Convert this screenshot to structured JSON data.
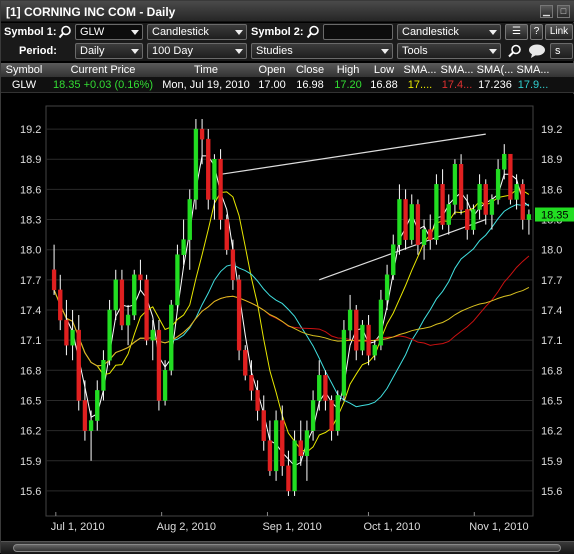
{
  "window": {
    "title": "[1] CORNING INC COM - Daily"
  },
  "toolbar": {
    "symbol1_label": "Symbol 1:",
    "symbol1_value": "GLW",
    "chart_type1": "Candlestick",
    "symbol2_label": "Symbol 2:",
    "symbol2_value": "",
    "chart_type2": "Candlestick",
    "help_label": "?",
    "link_label": "Link",
    "period_label": "Period:",
    "period_value": "Daily",
    "range_value": "100 Day",
    "studies_value": "Studies",
    "tools_value": "Tools",
    "extra_label": "s"
  },
  "quote": {
    "headers": [
      "Symbol",
      "Current Price",
      "Time",
      "Open",
      "Close",
      "High",
      "Low",
      "SMA...",
      "SMA...",
      "SMA(...",
      "SMA..."
    ],
    "row": {
      "symbol": "GLW",
      "price": "18.35 +0.03 (0.16%)",
      "time": "Mon, Jul 19, 2010",
      "open": "17.00",
      "close": "16.98",
      "high": "17.20",
      "low": "16.88",
      "sma1": "17....",
      "sma2": "17.4...",
      "sma3": "17.236",
      "sma4": "17.9..."
    },
    "colors": {
      "price": "#33dd33",
      "high": "#33dd33",
      "sma1": "#e8e800",
      "sma2": "#e03030",
      "sma4": "#30d0d0"
    }
  },
  "chart_data": {
    "type": "candlestick",
    "ylim": [
      15.45,
      19.35
    ],
    "y_ticks": [
      15.6,
      15.9,
      16.2,
      16.5,
      16.8,
      17.1,
      17.4,
      17.7,
      18.0,
      18.3,
      18.6,
      18.9,
      19.2
    ],
    "x_tick_labels": [
      "Jul 1, 2010",
      "Aug 2, 2010",
      "Sep 1, 2010",
      "Oct 1, 2010",
      "Nov 1, 2010"
    ],
    "last_price_label": "18.35",
    "colors": {
      "up": "#22dd22",
      "down": "#e02020",
      "sma_fast": "#ffffff",
      "sma_short": "#e8e800",
      "sma_mid": "#40e0e0",
      "sma_long": "#cc1111",
      "sma_slow": "#d8c020",
      "channel": "#dddddd",
      "grid": "#2a2a2a"
    },
    "candles": [
      [
        17.8,
        18.05,
        17.55,
        17.6
      ],
      [
        17.6,
        17.75,
        17.2,
        17.3
      ],
      [
        17.3,
        17.5,
        16.95,
        17.05
      ],
      [
        17.05,
        17.4,
        16.9,
        17.2
      ],
      [
        17.2,
        17.35,
        16.4,
        16.5
      ],
      [
        16.5,
        16.7,
        16.1,
        16.2
      ],
      [
        16.2,
        16.4,
        15.9,
        16.3
      ],
      [
        16.3,
        16.7,
        16.2,
        16.6
      ],
      [
        16.6,
        17.0,
        16.5,
        16.9
      ],
      [
        16.9,
        17.5,
        16.85,
        17.4
      ],
      [
        17.4,
        17.8,
        17.3,
        17.7
      ],
      [
        17.7,
        17.8,
        17.2,
        17.25
      ],
      [
        17.25,
        17.45,
        17.05,
        17.35
      ],
      [
        17.35,
        17.8,
        17.3,
        17.75
      ],
      [
        17.75,
        17.9,
        17.6,
        17.7
      ],
      [
        17.7,
        17.75,
        17.05,
        17.1
      ],
      [
        17.1,
        17.3,
        16.9,
        17.2
      ],
      [
        17.2,
        17.3,
        16.4,
        16.5
      ],
      [
        16.5,
        16.9,
        16.45,
        16.8
      ],
      [
        16.8,
        17.5,
        16.75,
        17.45
      ],
      [
        17.45,
        18.05,
        17.4,
        17.95
      ],
      [
        17.95,
        18.3,
        17.85,
        18.1
      ],
      [
        18.1,
        18.6,
        17.8,
        18.5
      ],
      [
        18.5,
        19.3,
        18.4,
        19.2
      ],
      [
        19.2,
        19.3,
        18.85,
        19.1
      ],
      [
        19.1,
        19.2,
        18.4,
        18.5
      ],
      [
        18.5,
        18.95,
        18.3,
        18.9
      ],
      [
        18.9,
        19.0,
        18.2,
        18.3
      ],
      [
        18.3,
        18.35,
        17.95,
        18.0
      ],
      [
        18.0,
        18.1,
        17.6,
        17.7
      ],
      [
        17.7,
        17.75,
        16.9,
        17.0
      ],
      [
        17.0,
        17.05,
        16.7,
        16.75
      ],
      [
        16.75,
        16.9,
        16.5,
        16.6
      ],
      [
        16.6,
        16.7,
        16.3,
        16.4
      ],
      [
        16.4,
        16.55,
        16.0,
        16.1
      ],
      [
        16.1,
        16.3,
        15.75,
        15.8
      ],
      [
        15.8,
        16.4,
        15.7,
        16.3
      ],
      [
        16.3,
        16.45,
        15.75,
        15.85
      ],
      [
        15.85,
        16.0,
        15.55,
        15.6
      ],
      [
        15.6,
        16.2,
        15.55,
        16.1
      ],
      [
        16.1,
        16.3,
        15.85,
        15.95
      ],
      [
        15.95,
        16.3,
        15.7,
        16.2
      ],
      [
        16.2,
        16.6,
        16.1,
        16.5
      ],
      [
        16.5,
        16.9,
        16.4,
        16.75
      ],
      [
        16.75,
        16.8,
        16.4,
        16.5
      ],
      [
        16.5,
        16.55,
        16.1,
        16.2
      ],
      [
        16.2,
        16.6,
        16.15,
        16.55
      ],
      [
        16.55,
        17.3,
        16.5,
        17.2
      ],
      [
        17.2,
        17.55,
        17.1,
        17.4
      ],
      [
        17.4,
        17.45,
        16.9,
        17.0
      ],
      [
        17.0,
        17.3,
        16.95,
        17.25
      ],
      [
        17.25,
        17.35,
        16.85,
        16.95
      ],
      [
        16.95,
        17.1,
        16.9,
        17.05
      ],
      [
        17.05,
        17.6,
        17.0,
        17.5
      ],
      [
        17.5,
        17.85,
        17.4,
        17.75
      ],
      [
        17.75,
        18.15,
        17.7,
        18.05
      ],
      [
        18.05,
        18.65,
        17.95,
        18.5
      ],
      [
        18.5,
        18.6,
        18.0,
        18.1
      ],
      [
        18.1,
        18.55,
        18.05,
        18.45
      ],
      [
        18.45,
        18.5,
        17.95,
        18.05
      ],
      [
        18.05,
        18.3,
        17.9,
        18.2
      ],
      [
        18.2,
        18.35,
        18.0,
        18.1
      ],
      [
        18.1,
        18.75,
        18.05,
        18.65
      ],
      [
        18.65,
        18.8,
        18.2,
        18.25
      ],
      [
        18.25,
        18.55,
        18.15,
        18.45
      ],
      [
        18.45,
        18.9,
        18.35,
        18.85
      ],
      [
        18.85,
        18.95,
        18.35,
        18.4
      ],
      [
        18.4,
        18.55,
        18.1,
        18.2
      ],
      [
        18.2,
        18.45,
        18.15,
        18.4
      ],
      [
        18.4,
        18.75,
        18.3,
        18.65
      ],
      [
        18.65,
        18.7,
        18.25,
        18.35
      ],
      [
        18.35,
        18.55,
        18.2,
        18.5
      ],
      [
        18.5,
        18.9,
        18.45,
        18.8
      ],
      [
        18.8,
        19.05,
        18.7,
        18.95
      ],
      [
        18.95,
        18.95,
        18.45,
        18.5
      ],
      [
        18.5,
        18.75,
        18.4,
        18.65
      ],
      [
        18.65,
        18.7,
        18.2,
        18.3
      ],
      [
        18.3,
        18.4,
        18.15,
        18.35
      ]
    ]
  }
}
